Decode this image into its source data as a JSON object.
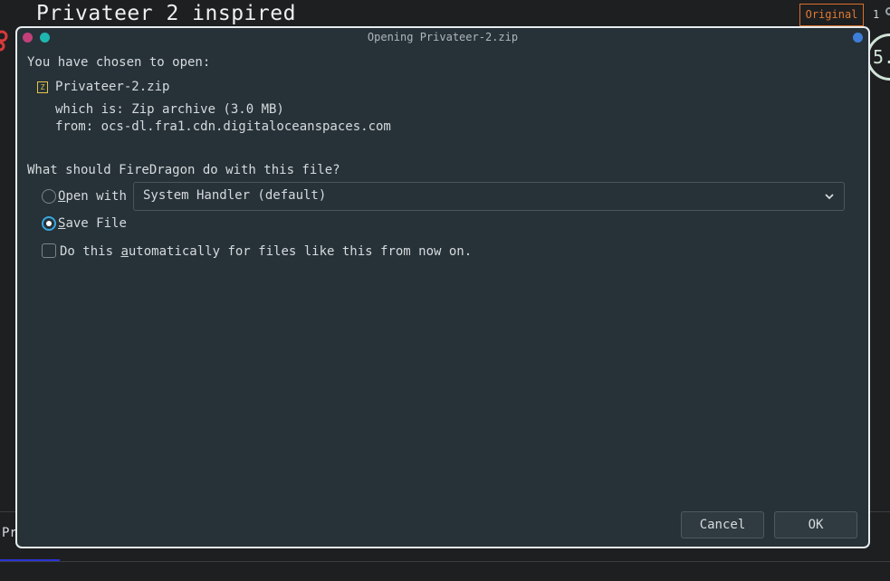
{
  "background": {
    "page_title": "Privateer 2 inspired",
    "badge_label": "Original",
    "count": "1",
    "score_text": "5.",
    "footer_text": "Pr",
    "colors": {
      "badge": "#e07a30",
      "link_underline": "#2a34d8"
    }
  },
  "dialog": {
    "title": "Opening Privateer-2.zip",
    "chosen_label": "You have chosen to open:",
    "file_icon": "zip-archive-icon",
    "filename": "Privateer-2.zip",
    "which_is": "which is: Zip archive (3.0 MB)",
    "from": "from: ocs-dl.fra1.cdn.digitaloceanspaces.com",
    "question": "What should FireDragon do with this file?",
    "open_with": {
      "label_accesskey": "O",
      "label_rest": "pen with",
      "selected": false,
      "handler_value": "System Handler (default)"
    },
    "save_file": {
      "label_accesskey": "S",
      "label_rest": "ave File",
      "selected": true
    },
    "auto": {
      "label_before": "Do this ",
      "label_accesskey": "a",
      "label_after": "utomatically for files like this from now on.",
      "checked": false
    },
    "buttons": {
      "cancel": "Cancel",
      "ok": "OK"
    },
    "colors": {
      "background": "#263238",
      "close_dot": "#c2407a",
      "min_dot": "#1fb6b0",
      "max_dot": "#3d7fd8",
      "radio_accent": "#3aa7de"
    }
  }
}
